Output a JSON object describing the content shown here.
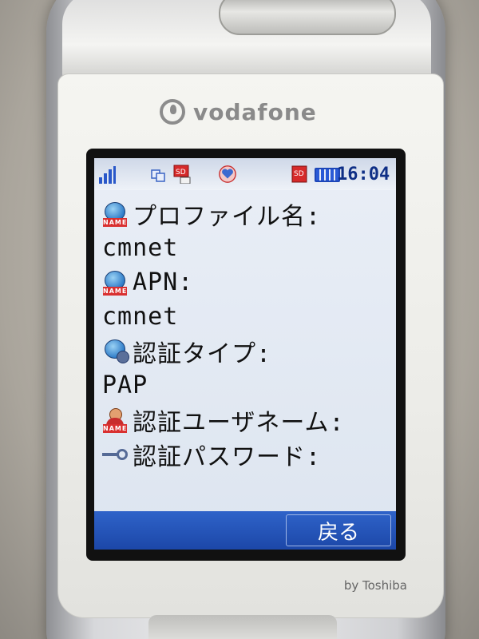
{
  "brand": {
    "name": "vodafone",
    "maker": "by Toshiba"
  },
  "status_bar": {
    "icons": [
      "signal-icon",
      "sync-icon",
      "sd-icon",
      "heart-mail-icon",
      "sd-card-icon",
      "battery-icon"
    ],
    "time": "16:04"
  },
  "settings": {
    "profile_name_label": "プロファイル名:",
    "profile_name_value": "cmnet",
    "apn_label": "APN:",
    "apn_value": "cmnet",
    "auth_type_label": "認証タイプ:",
    "auth_type_value": "PAP",
    "auth_user_label": "認証ユーザネーム:",
    "auth_password_label": "認証パスワード:"
  },
  "softkeys": {
    "back_label": "戻る"
  },
  "colors": {
    "softbar": "#1c47a8",
    "clock": "#0f2f86",
    "nametag": "#d93030"
  }
}
